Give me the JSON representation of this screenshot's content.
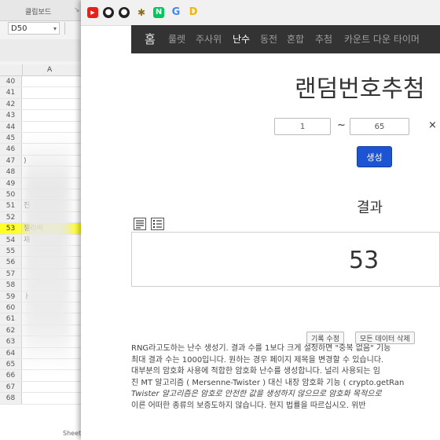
{
  "spreadsheet": {
    "title": "클립보드",
    "cell_reference": "D50",
    "column_header": "A",
    "rows": [
      {
        "num": "40",
        "text": ""
      },
      {
        "num": "41",
        "text": ""
      },
      {
        "num": "42",
        "text": ""
      },
      {
        "num": "43",
        "text": ""
      },
      {
        "num": "44",
        "text": ""
      },
      {
        "num": "45",
        "text": ""
      },
      {
        "num": "46",
        "text": ""
      },
      {
        "num": "47",
        "text": ")"
      },
      {
        "num": "48",
        "text": ""
      },
      {
        "num": "49",
        "text": ""
      },
      {
        "num": "50",
        "text": ""
      },
      {
        "num": "51",
        "text": "진"
      },
      {
        "num": "52",
        "text": ""
      },
      {
        "num": "53",
        "text": "젤리삐"
      },
      {
        "num": "54",
        "text": "재"
      },
      {
        "num": "55",
        "text": ""
      },
      {
        "num": "56",
        "text": ""
      },
      {
        "num": "57",
        "text": ""
      },
      {
        "num": "58",
        "text": ""
      },
      {
        "num": "59",
        "text": "ㅏ"
      },
      {
        "num": "60",
        "text": ""
      },
      {
        "num": "61",
        "text": ""
      },
      {
        "num": "62",
        "text": ""
      },
      {
        "num": "63",
        "text": ""
      },
      {
        "num": "64",
        "text": ""
      },
      {
        "num": "65",
        "text": ""
      },
      {
        "num": "66",
        "text": ""
      },
      {
        "num": "67",
        "text": ""
      },
      {
        "num": "68",
        "text": ""
      }
    ],
    "highlight_row": "53",
    "highlight_color": "#ffff2a",
    "sheet_tab": "Sheet"
  },
  "bookmarks": [
    {
      "name": "youtube-icon",
      "glyph": "▶"
    },
    {
      "name": "github-icon",
      "glyph": "●"
    },
    {
      "name": "github-icon-2",
      "glyph": "●"
    },
    {
      "name": "gear-icon",
      "glyph": "✱"
    },
    {
      "name": "naver-icon",
      "glyph": "N"
    },
    {
      "name": "google-icon",
      "glyph": "G"
    },
    {
      "name": "drive-icon",
      "glyph": "D"
    }
  ],
  "nav": {
    "brand": "홈",
    "items": [
      "룰렛",
      "주사위",
      "난수",
      "동전",
      "혼합",
      "추첨",
      "카운트 다운 타이머"
    ],
    "active": "난수"
  },
  "page": {
    "heading": "랜덤번호추첨",
    "min_value": "1",
    "max_value": "65",
    "tilde": "~",
    "close_glyph": "×",
    "generate_label": "생성",
    "result_label": "결과",
    "result_value": "53",
    "record_edit_label": "기록 수정",
    "delete_all_label": "모든 데이터 삭제"
  },
  "description": {
    "lines": [
      "RNG라고도하는 난수 생성기. 결과 수를 1보다 크게 설정하면 \"중복 없음\" 기능",
      "최대 결과 수는 1000입니다. 원하는 경우 페이지 제목을 변경할 수 있습니다.",
      "대부분의 암호화 사용에 적합한 암호화 난수를 생성합니다. 널리 사용되는 임",
      "진 MT 알고리즘 ( Mersenne-Twister ) 대신 내장 암호화 기능 ( crypto.getRan",
      "Twister 알고리즘은 암호로 안전한 값을 생성하지 않으므로 암호화 목적으로",
      "이른 어떠한 종류의 보증도하지 않습니다. 현지 법률을 따르십시오. 위반"
    ]
  },
  "colors": {
    "navbar_bg": "#333333",
    "generate_button": "#1d54d4",
    "highlight": "#ffff2a"
  }
}
